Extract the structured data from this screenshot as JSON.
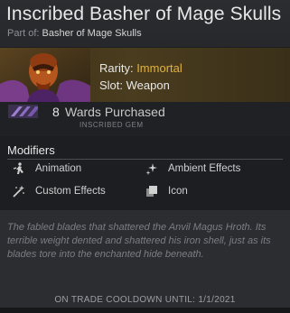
{
  "item": {
    "title": "Inscribed Basher of Mage Skulls",
    "part_of_label": "Part of:",
    "set_name": "Basher of Mage Skulls",
    "rarity_label": "Rarity:",
    "rarity_value": "Immortal",
    "rarity_color": "#e3b13d",
    "slot_text": "Slot: Weapon"
  },
  "gem": {
    "count": "8",
    "label": "Wards Purchased",
    "type": "INSCRIBED GEM"
  },
  "modifiers": {
    "heading": "Modifiers",
    "items": [
      {
        "label": "Animation",
        "icon": "running-figure-icon"
      },
      {
        "label": "Ambient Effects",
        "icon": "sparkles-icon"
      },
      {
        "label": "Custom Effects",
        "icon": "magic-wand-icon"
      },
      {
        "label": "Icon",
        "icon": "stacked-squares-icon"
      }
    ]
  },
  "description": "The fabled blades that shattered the Anvil Magus Hroth. Its terrible weight dented and shattered his iron shell, just as its blades tore into the enchanted hide beneath.",
  "cooldown": "ON TRADE COOLDOWN UNTIL: 1/1/2021"
}
